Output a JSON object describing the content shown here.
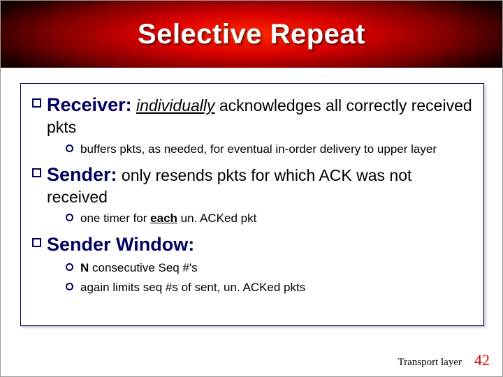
{
  "title": "Selective Repeat",
  "sections": [
    {
      "head": "Receiver:",
      "head_emph": "individually",
      "head_rest": " acknowledges all correctly received pkts",
      "subs": [
        {
          "text": "buffers pkts, as needed, for eventual in-order delivery to upper layer"
        }
      ]
    },
    {
      "head": "Sender:",
      "head_rest": " only resends pkts for which ACK was not received",
      "subs": [
        {
          "pre": "one timer for ",
          "bold": "each",
          "post": " un. ACKed pkt"
        }
      ]
    },
    {
      "head": "Sender Window:",
      "subs": [
        {
          "bold_lead": "N",
          "post": " consecutive Seq #'s"
        },
        {
          "text": "again limits seq #s of sent, un. ACKed pkts"
        }
      ]
    }
  ],
  "footer": {
    "label": "Transport layer",
    "page": "42"
  }
}
